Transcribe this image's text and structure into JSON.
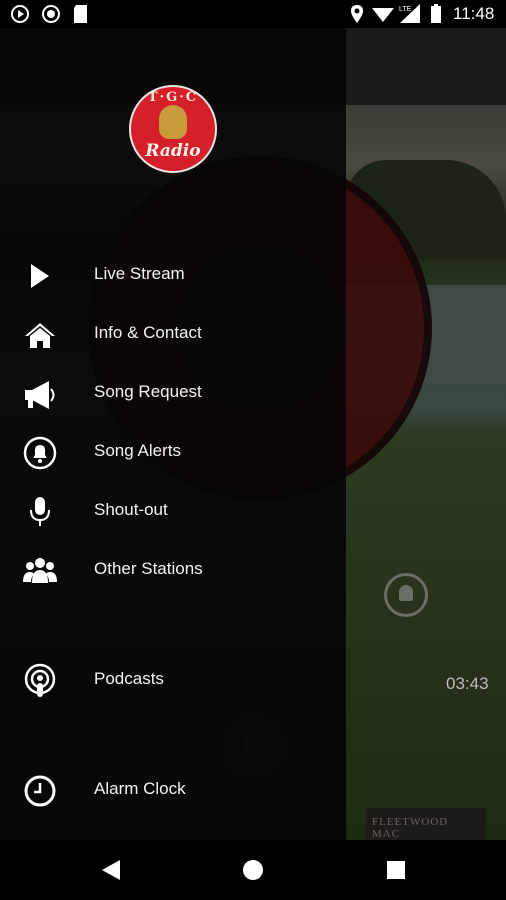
{
  "status_bar": {
    "time": "11:48",
    "network": "LTE"
  },
  "drawer": {
    "logo": {
      "top_text": "T·G·C",
      "bottom_text": "Radio"
    },
    "menu": [
      {
        "label": "Live Stream",
        "icon": "play-icon"
      },
      {
        "label": "Info & Contact",
        "icon": "home-icon"
      },
      {
        "label": "Song Request",
        "icon": "megaphone-icon"
      },
      {
        "label": "Song Alerts",
        "icon": "bell-icon"
      },
      {
        "label": "Shout-out",
        "icon": "microphone-icon"
      },
      {
        "label": "Other Stations",
        "icon": "users-icon"
      },
      {
        "label": "Podcasts",
        "icon": "podcast-icon"
      },
      {
        "label": "Alarm Clock",
        "icon": "clock-icon"
      }
    ]
  },
  "background_player": {
    "elapsed_time": "03:43",
    "album_art_text": "FLEETWOOD MAC"
  },
  "colors": {
    "drawer_bg": "#060606",
    "logo_red": "#d5202a",
    "text": "#f3f3f3"
  }
}
